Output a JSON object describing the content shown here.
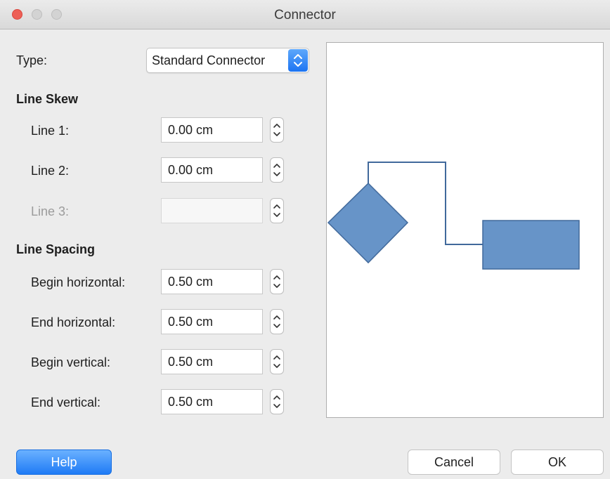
{
  "window": {
    "title": "Connector"
  },
  "type": {
    "label": "Type:",
    "value": "Standard Connector"
  },
  "line_skew": {
    "title": "Line Skew",
    "fields": [
      {
        "label": "Line 1:",
        "value": "0.00 cm"
      },
      {
        "label": "Line 2:",
        "value": "0.00 cm"
      },
      {
        "label": "Line 3:",
        "value": ""
      }
    ]
  },
  "line_spacing": {
    "title": "Line Spacing",
    "fields": [
      {
        "label": "Begin horizontal:",
        "value": "0.50 cm"
      },
      {
        "label": "End horizontal:",
        "value": "0.50 cm"
      },
      {
        "label": "Begin vertical:",
        "value": "0.50 cm"
      },
      {
        "label": "End vertical:",
        "value": "0.50 cm"
      }
    ]
  },
  "preview": {
    "shape_fill": "#6794c8",
    "shape_stroke": "#41699b",
    "connector_color": "#41699b"
  },
  "buttons": {
    "help": "Help",
    "cancel": "Cancel",
    "ok": "OK"
  },
  "colors": {
    "accent": "#1f7bf5",
    "close": "#ed5f56"
  }
}
